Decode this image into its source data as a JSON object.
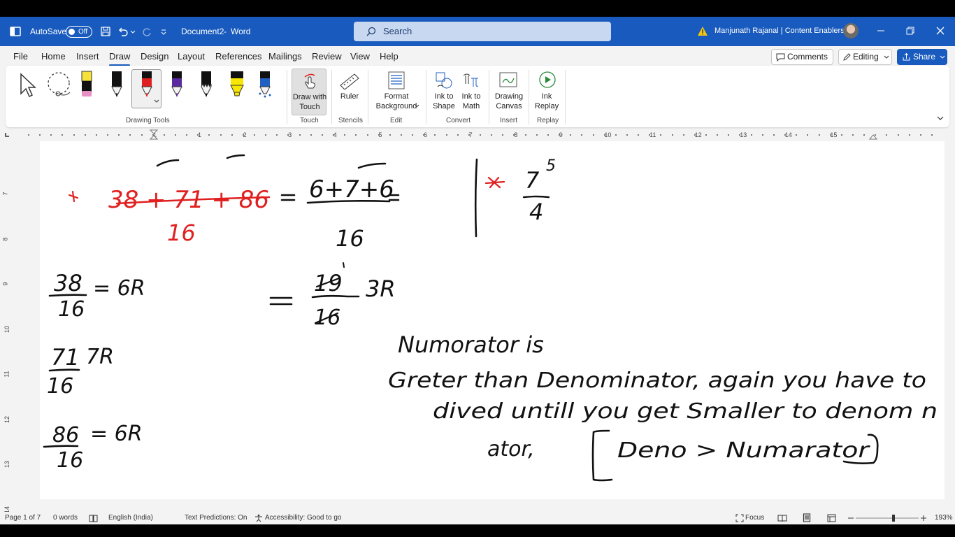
{
  "titlebar": {
    "autosave_label": "AutoSave",
    "autosave_state": "Off",
    "document_title": "Document2",
    "separator": "-",
    "app_name": "Word",
    "search_placeholder": "Search",
    "user_name": "Manjunath Rajanal | Content Enablers"
  },
  "menu": {
    "tabs": [
      "File",
      "Home",
      "Insert",
      "Draw",
      "Design",
      "Layout",
      "References",
      "Mailings",
      "Review",
      "View",
      "Help"
    ],
    "comments_label": "Comments",
    "editing_label": "Editing",
    "share_label": "Share"
  },
  "ribbon": {
    "groups": {
      "drawing_tools": "Drawing Tools",
      "touch": "Touch",
      "stencils": "Stencils",
      "edit": "Edit",
      "convert": "Convert",
      "insert": "Insert",
      "replay": "Replay"
    },
    "buttons": {
      "draw_with_touch_1": "Draw with",
      "draw_with_touch_2": "Touch",
      "ruler": "Ruler",
      "format_bg_1": "Format",
      "format_bg_2": "Background",
      "ink_shape_1": "Ink to",
      "ink_shape_2": "Shape",
      "ink_math_1": "Ink to",
      "ink_math_2": "Math",
      "canvas_1": "Drawing",
      "canvas_2": "Canvas",
      "replay_1": "Ink",
      "replay_2": "Replay"
    },
    "pen_colors": [
      "#f6e23a",
      "#111111",
      "#e02020",
      "#5a2aa0",
      "#111111",
      "#f7e600",
      "#2060c0"
    ]
  },
  "ruler": {
    "numbers": [
      "1",
      "1",
      "2",
      "3",
      "4",
      "5",
      "6",
      "7",
      "8",
      "9",
      "10",
      "11",
      "12",
      "13",
      "14",
      "15"
    ],
    "vertical_numbers": [
      "7",
      "8",
      "9",
      "10",
      "11",
      "12",
      "13",
      "14"
    ]
  },
  "ink": {
    "top_left_sum": "38 + 71 + 86",
    "top_left_den": "16",
    "top_mid_num": "6+7+6",
    "top_mid_den": "16",
    "top_right_num": "7",
    "top_right_exp": "5",
    "top_right_den": "4",
    "row1_num": "38",
    "row1_den": "16",
    "row1_res": "= 6R",
    "mid_num": "19",
    "mid_den": "16",
    "mid_res": "3R",
    "row2_num": "71",
    "row2_den": "16",
    "row2_res": "7R",
    "row3_num": "86",
    "row3_den": "16",
    "row3_res": "= 6R",
    "note_line1": "Numorator is",
    "note_line2": "Greter than Denominator,  again you have to",
    "note_line3": "dived  untill  you get Smaller to denom n",
    "note_line4": "ator,",
    "note_bracket": "Deno > Numarator"
  },
  "status": {
    "page": "Page 1 of 7",
    "words": "0 words",
    "language": "English (India)",
    "predictions": "Text Predictions: On",
    "accessibility": "Accessibility: Good to go",
    "focus": "Focus",
    "zoom": "193%"
  }
}
